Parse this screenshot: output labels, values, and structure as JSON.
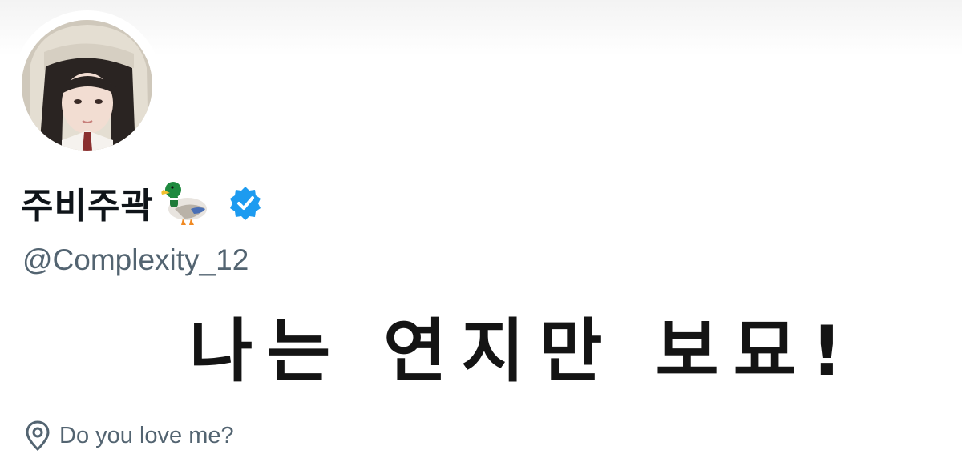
{
  "profile": {
    "display_name": "주비주곽",
    "name_emoji": "duck-icon",
    "verified": true,
    "handle": "@Complexity_12",
    "bio": "나는 연지만 보묘!",
    "location": "Do you love me?"
  },
  "icons": {
    "verified": "verified-badge-icon",
    "location": "location-pin-icon"
  },
  "colors": {
    "verified_blue": "#1d9bf0",
    "secondary_text": "#536471",
    "primary_text": "#0f1419"
  }
}
